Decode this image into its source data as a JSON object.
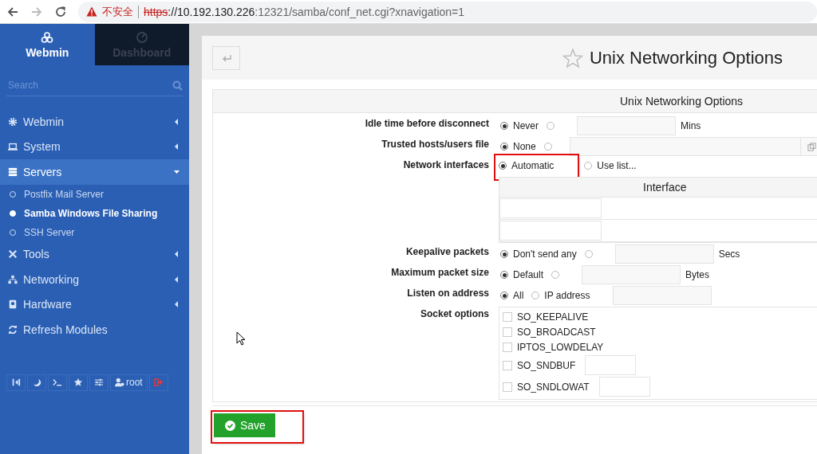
{
  "browser": {
    "url_parts": [
      {
        "kind": "struck",
        "text": "https"
      },
      {
        "kind": "host",
        "text": "://10.192.130.226"
      },
      {
        "kind": "path",
        "text": ":12321/samba/conf_net.cgi?xnavigation=1"
      }
    ],
    "security_label": "不安全"
  },
  "sidebar": {
    "tabs": [
      {
        "label": "Webmin",
        "selected": true
      },
      {
        "label": "Dashboard",
        "selected": false
      }
    ],
    "search": {
      "placeholder": "Search"
    },
    "items": [
      {
        "label": "Webmin",
        "expanded": false,
        "has_caret": true
      },
      {
        "label": "System",
        "expanded": false,
        "has_caret": true
      },
      {
        "label": "Servers",
        "expanded": true,
        "has_caret": true,
        "children": [
          {
            "label": "Postfix Mail Server",
            "selected": false
          },
          {
            "label": "Samba Windows File Sharing",
            "selected": true
          },
          {
            "label": "SSH Server",
            "selected": false
          }
        ]
      },
      {
        "label": "Tools",
        "expanded": false,
        "has_caret": true
      },
      {
        "label": "Networking",
        "expanded": false,
        "has_caret": true
      },
      {
        "label": "Hardware",
        "expanded": false,
        "has_caret": true
      },
      {
        "label": "Refresh Modules",
        "expanded": false,
        "has_caret": false
      }
    ],
    "user": "root"
  },
  "page": {
    "title": "Unix Networking Options",
    "favorite": false,
    "form": {
      "title": "Unix Networking Options",
      "rows": [
        {
          "kind": "radio",
          "label": "Idle time before disconnect",
          "options": [
            {
              "label": "Never",
              "selected": true,
              "highlighted": false
            },
            {
              "selected": false,
              "highlighted": false
            }
          ],
          "field": true,
          "unit": "Mins"
        },
        {
          "kind": "radio",
          "label": "Trusted hosts/users file",
          "options": [
            {
              "label": "None",
              "selected": true,
              "highlighted": false
            },
            {
              "selected": false,
              "highlighted": false
            }
          ],
          "file_field": true
        },
        {
          "kind": "radio",
          "label": "Network interfaces",
          "options": [
            {
              "label": "Automatic",
              "selected": true,
              "highlighted": true
            },
            {
              "label": "Use list...",
              "selected": false,
              "highlighted": false
            }
          ],
          "table": {
            "header": "Interface"
          }
        },
        {
          "kind": "radio",
          "label": "Keepalive packets",
          "options": [
            {
              "label": "Don't send any",
              "selected": true,
              "highlighted": false
            },
            {
              "selected": false,
              "highlighted": false
            }
          ],
          "field": true,
          "unit": "Secs"
        },
        {
          "kind": "radio",
          "label": "Maximum packet size",
          "options": [
            {
              "label": "Default",
              "selected": true,
              "highlighted": false
            },
            {
              "selected": false,
              "highlighted": false
            }
          ],
          "field": true,
          "unit": "Bytes"
        },
        {
          "kind": "radio",
          "label": "Listen on address",
          "options": [
            {
              "label": "All",
              "selected": true,
              "highlighted": false
            },
            {
              "label": "IP address",
              "selected": false,
              "highlighted": false
            }
          ],
          "field": true
        },
        {
          "kind": "checks",
          "label": "Socket options",
          "checks": [
            {
              "label": "SO_KEEPALIVE",
              "checked": false
            },
            {
              "label": "SO_BROADCAST",
              "checked": false
            },
            {
              "label": "IPTOS_LOWDELAY",
              "checked": false
            },
            {
              "label": "SO_SNDBUF",
              "checked": false,
              "field": true
            },
            {
              "label": "SO_SNDLOWAT",
              "checked": false,
              "field": true
            }
          ]
        }
      ]
    },
    "save": {
      "label": "Save",
      "highlighted": true
    }
  }
}
